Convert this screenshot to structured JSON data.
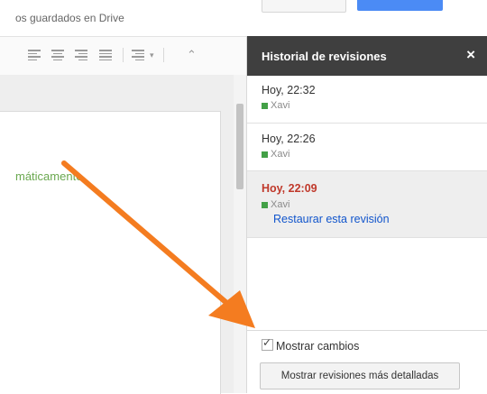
{
  "header": {
    "saved_text": "os guardados en Drive"
  },
  "toolbar": {
    "icons": [
      "align-left-icon",
      "align-center-icon",
      "align-right-icon",
      "align-justify-icon",
      "line-spacing-icon",
      "collapse-icon"
    ],
    "collapse_glyph": "⌃"
  },
  "document": {
    "visible_text": "máticamente."
  },
  "panel": {
    "title": "Historial de revisiones",
    "close_glyph": "×",
    "revisions": [
      {
        "time": "Hoy, 22:32",
        "author": "Xavi"
      },
      {
        "time": "Hoy, 22:26",
        "author": "Xavi"
      },
      {
        "time": "Hoy, 22:09",
        "author": "Xavi",
        "selected": true,
        "restore_label": "Restaurar esta revisión"
      }
    ],
    "author_color": "#43a047",
    "show_changes_label": "Mostrar cambios",
    "show_changes_checked": true,
    "detail_button_label": "Mostrar revisiones más detalladas"
  },
  "colors": {
    "panel_header": "#3f3f3f",
    "selected_time": "#c0392b",
    "link": "#1155cc",
    "doc_text": "#6aa84f",
    "arrow": "#f47c20"
  }
}
